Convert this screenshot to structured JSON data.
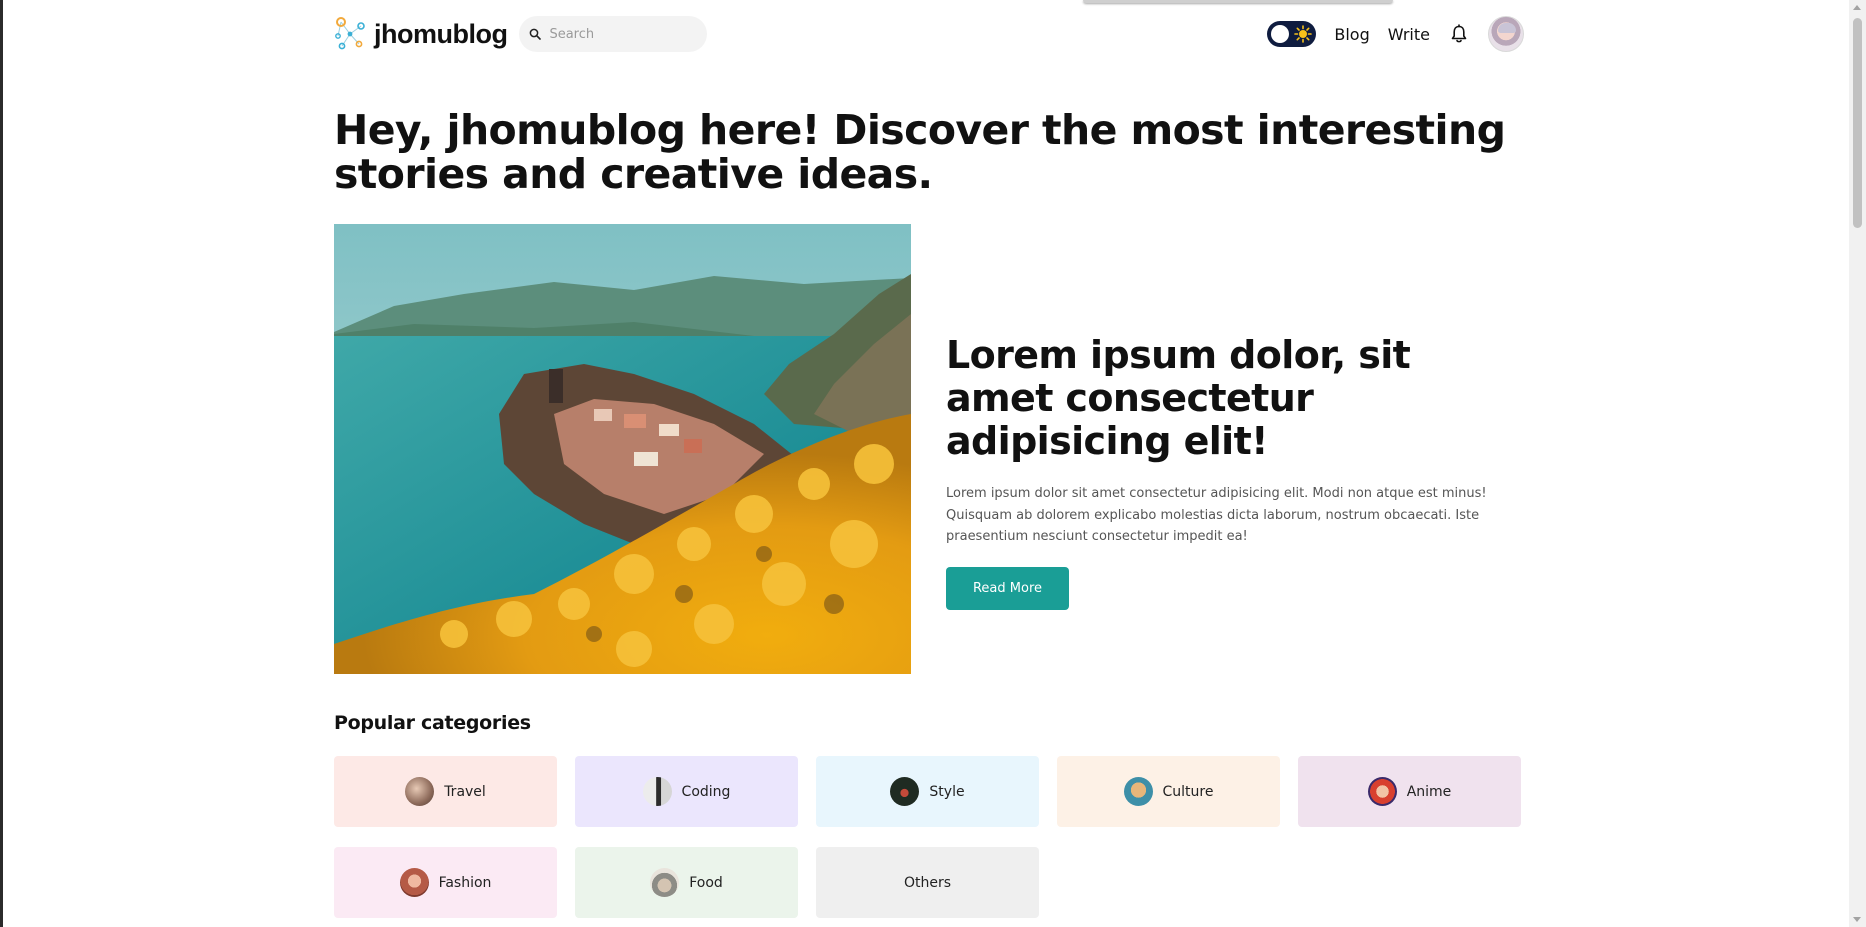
{
  "brand": {
    "name": "jhomublog"
  },
  "search": {
    "placeholder": "Search"
  },
  "nav": {
    "links": [
      "Blog",
      "Write"
    ]
  },
  "icons": {
    "logo": "network-logo-icon",
    "search": "search-icon",
    "theme": "sun-icon",
    "notifications": "bell-icon",
    "profile": "avatar"
  },
  "hero": {
    "bold": "Hey, jhomublog here!",
    "text": " Discover the most interesting stories and creative ideas."
  },
  "featured": {
    "title": "Lorem ipsum dolor, sit amet consectetur adipisicing elit!",
    "description": "Lorem ipsum dolor sit amet consectetur adipisicing elit. Modi non atque est minus! Quisquam ab dolorem explicabo molestias dicta laborum, nostrum obcaecati. Iste praesentium nesciunt consectetur impedit ea!",
    "button": "Read More"
  },
  "categories": {
    "title": "Popular categories",
    "items": [
      {
        "label": "Travel",
        "bg": "#fde9e6"
      },
      {
        "label": "Coding",
        "bg": "#ebe6fd"
      },
      {
        "label": "Style",
        "bg": "#e8f6fd"
      },
      {
        "label": "Culture",
        "bg": "#fdf1e6"
      },
      {
        "label": "Anime",
        "bg": "#f0e2ee"
      },
      {
        "label": "Fashion",
        "bg": "#fbeaf4"
      },
      {
        "label": "Food",
        "bg": "#ebf4eb"
      },
      {
        "label": "Others",
        "bg": "#efefef"
      }
    ]
  },
  "colors": {
    "accent": "#1a9e96",
    "toggle": "#0f1c3f"
  }
}
